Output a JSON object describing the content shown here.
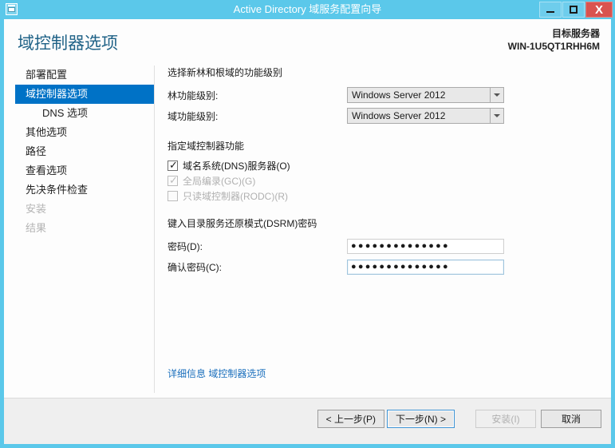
{
  "window": {
    "title": "Active Directory 域服务配置向导",
    "icon": "wizard-icon",
    "minimize_label": "",
    "maximize_label": "",
    "close_label": "X",
    "accent_color": "#5bc8ea"
  },
  "header": {
    "page_title": "域控制器选项",
    "target_server_label": "目标服务器",
    "target_server_name": "WIN-1U5QT1RHH6M"
  },
  "sidebar": {
    "items": [
      {
        "label": "部署配置",
        "state": "normal",
        "indent": false
      },
      {
        "label": "域控制器选项",
        "state": "selected",
        "indent": false
      },
      {
        "label": "DNS 选项",
        "state": "normal",
        "indent": true
      },
      {
        "label": "其他选项",
        "state": "normal",
        "indent": false
      },
      {
        "label": "路径",
        "state": "normal",
        "indent": false
      },
      {
        "label": "查看选项",
        "state": "normal",
        "indent": false
      },
      {
        "label": "先决条件检查",
        "state": "normal",
        "indent": false
      },
      {
        "label": "安装",
        "state": "disabled",
        "indent": false
      },
      {
        "label": "结果",
        "state": "disabled",
        "indent": false
      }
    ]
  },
  "main": {
    "functional_level": {
      "heading": "选择新林和根域的功能级别",
      "forest_label": "林功能级别:",
      "forest_value": "Windows Server 2012",
      "domain_label": "域功能级别:",
      "domain_value": "Windows Server 2012",
      "dropdown_icon": "chevron-down-icon"
    },
    "capabilities": {
      "heading": "指定域控制器功能",
      "items": [
        {
          "label": "域名系统(DNS)服务器(O)",
          "checked": true,
          "disabled": false
        },
        {
          "label": "全局编录(GC)(G)",
          "checked": true,
          "disabled": true
        },
        {
          "label": "只读域控制器(RODC)(R)",
          "checked": false,
          "disabled": true
        }
      ],
      "check_glyph": "✓"
    },
    "dsrm": {
      "heading": "键入目录服务还原模式(DSRM)密码",
      "password_label": "密码(D):",
      "password_value": "●●●●●●●●●●●●●●",
      "confirm_label": "确认密码(C):",
      "confirm_value": "●●●●●●●●●●●●●●",
      "confirm_focused": true
    },
    "more_info": {
      "prefix": "详细信息",
      "link": "域控制器选项",
      "color": "#1a6fbd"
    }
  },
  "footer": {
    "buttons": [
      {
        "label": "< 上一步(P)",
        "state": "normal",
        "name": "back-button"
      },
      {
        "label": "下一步(N) >",
        "state": "default",
        "name": "next-button"
      },
      {
        "label": "安装(I)",
        "state": "disabled",
        "name": "install-button"
      },
      {
        "label": "取消",
        "state": "normal",
        "name": "cancel-button"
      }
    ]
  }
}
